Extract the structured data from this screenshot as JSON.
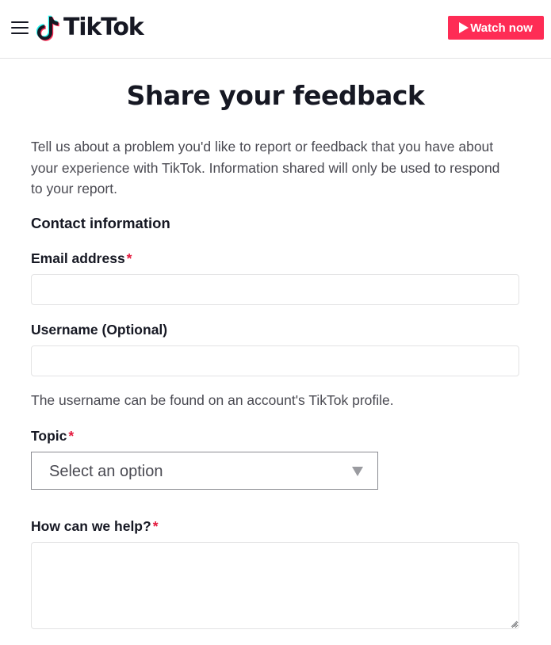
{
  "header": {
    "menu_icon": "hamburger-menu-icon",
    "logo_icon": "tiktok-note-icon",
    "logo_text": "TikTok",
    "watch_button": {
      "icon": "play-icon",
      "label": "Watch now"
    },
    "brand_color": "#fe2c55"
  },
  "page": {
    "title": "Share your feedback",
    "intro": "Tell us about a problem you'd like to report or feedback that you have about your experience with TikTok. Information shared will only be used to respond to your report.",
    "section_heading": "Contact information"
  },
  "form": {
    "required_marker": "*",
    "email": {
      "label": "Email address",
      "value": "",
      "required": true
    },
    "username": {
      "label": "Username (Optional)",
      "value": "",
      "hint": "The username can be found on an account's TikTok profile."
    },
    "topic": {
      "label": "Topic",
      "selected": "Select an option",
      "arrow_icon": "triangle-down-icon",
      "required": true
    },
    "help": {
      "label": "How can we help?",
      "value": "",
      "required": true
    }
  }
}
